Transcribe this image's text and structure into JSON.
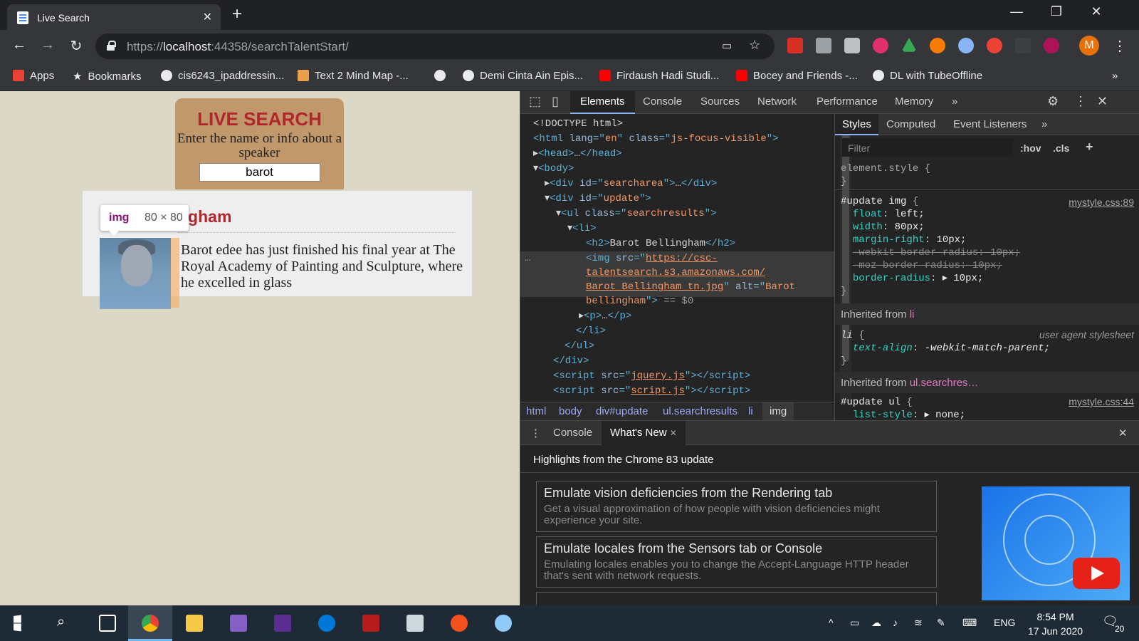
{
  "browser": {
    "tab_title": "Live Search",
    "url_prefix": "https://",
    "url_host": "localhost",
    "url_rest": ":44358/searchTalentStart/",
    "bookmarks": [
      "Apps",
      "Bookmarks",
      "cis6243_ipaddressin...",
      "Text 2 Mind Map -...",
      "Demi Cinta Ain Epis...",
      "Firdaush Hadi Studi...",
      "Bocey and Friends -...",
      "DL with TubeOffline"
    ],
    "profile_initial": "M"
  },
  "page": {
    "title": "LIVE SEARCH",
    "subtitle": "Enter the name or info about a speaker",
    "search_value": "barot",
    "result_name_visible": "ngham",
    "result_description": "Barot edee has just finished his final year at The Royal Academy of Painting and Sculpture, where he excelled in glass",
    "tooltip_tag": "img",
    "tooltip_dims": "80 × 80"
  },
  "devtools": {
    "tabs": [
      "Elements",
      "Console",
      "Sources",
      "Network",
      "Performance",
      "Memory"
    ],
    "breadcrumbs": [
      "html",
      "body",
      "div#update",
      "ul.searchresults",
      "li",
      "img"
    ],
    "styles_tabs": [
      "Styles",
      "Computed",
      "Event Listeners"
    ],
    "filter_placeholder": "Filter",
    "hov": ":hov",
    "cls": ".cls",
    "css_link_1": "mystyle.css:89",
    "css_link_2": "mystyle.css:44",
    "inherited_li": "Inherited from",
    "inherited_li_sel": "li",
    "inherited_ul_sel": "ul.searchres…",
    "ua_stylesheet": "user agent stylesheet",
    "drawer_tabs": [
      "Console",
      "What's New"
    ],
    "drawer_heading": "Highlights from the Chrome 83 update",
    "cards": [
      {
        "title": "Emulate vision deficiencies from the Rendering tab",
        "desc": "Get a visual approximation of how people with vision deficiencies might experience your site."
      },
      {
        "title": "Emulate locales from the Sensors tab or Console",
        "desc": "Emulating locales enables you to change the Accept-Language HTTP header that's sent with network requests."
      }
    ]
  },
  "taskbar": {
    "lang": "ENG",
    "time": "8:54 PM",
    "date": "17 Jun 2020",
    "notifications": "20"
  },
  "colors": {
    "accent_red": "#b1262c",
    "searchbox": "#c0986b",
    "page_bg": "#dcd8c8",
    "devtools_bg": "#242424"
  }
}
